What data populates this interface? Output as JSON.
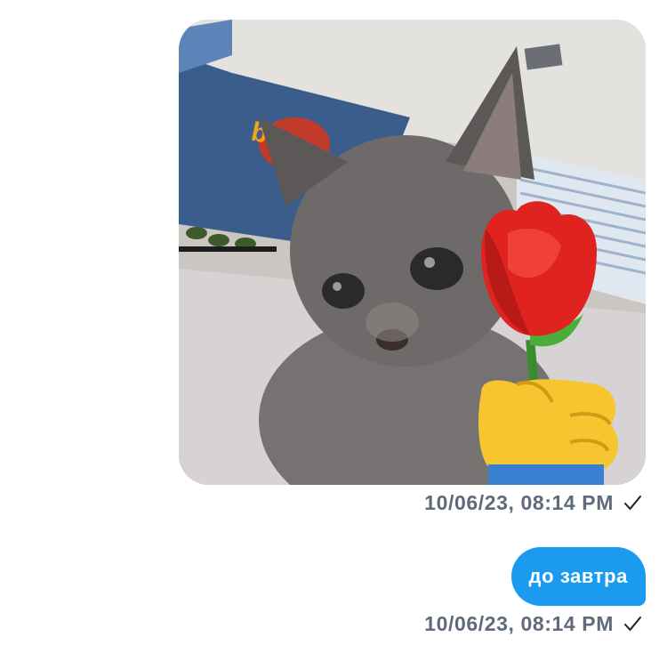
{
  "messages": [
    {
      "type": "image",
      "image_alt": "kitten holding a rose emoji",
      "timestamp": "10/06/23, 08:14 PM",
      "status_icon": "check-icon"
    },
    {
      "type": "text",
      "text": "до завтра",
      "timestamp": "10/06/23, 08:14 PM",
      "status_icon": "check-icon"
    }
  ],
  "colors": {
    "bubble": "#1a9bf0",
    "bubble_text": "#ffffff",
    "meta_text": "#5f6a7b"
  }
}
